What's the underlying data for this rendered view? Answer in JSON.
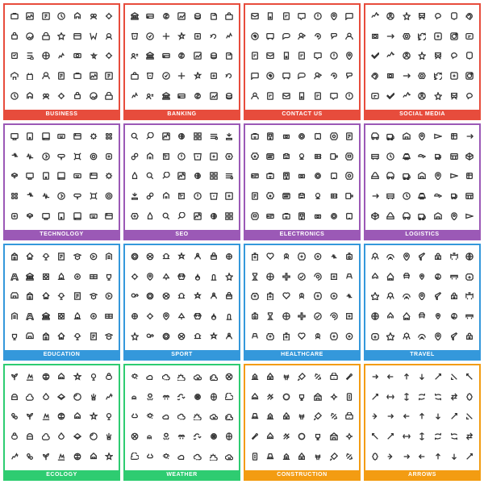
{
  "categories": [
    {
      "id": "business",
      "label": "BUSINESS",
      "class": "business",
      "icons": [
        "💼",
        "📊",
        "🏢",
        "📈",
        "👔",
        "🤝",
        "💡",
        "📋",
        "⚙️",
        "📌",
        "💰",
        "🖊",
        "📧",
        "📁",
        "👥",
        "📉",
        "🔗",
        "🏆",
        "💳",
        "📅",
        "🎯",
        "📑",
        "🔒",
        "🗂",
        "⏰",
        "📬",
        "💎",
        "🌐",
        "🔔",
        "🎖",
        "📣",
        "📞",
        "🗑",
        "✉",
        "🔑"
      ]
    },
    {
      "id": "banking",
      "label": "BANKING",
      "class": "banking",
      "icons": [
        "🏛",
        "💴",
        "📊",
        "💰",
        "🏦",
        "🐷",
        "💳",
        "🔐",
        "🏅",
        "📈",
        "⚖",
        "💵",
        "🪙",
        "🔒",
        "🧾",
        "💹",
        "📉",
        "🏧",
        "🔑",
        "💼",
        "🎖",
        "📋",
        "⚙",
        "🗃",
        "💡",
        "🤝",
        "💎",
        "📑",
        "🔔",
        "💱",
        "🛡",
        "🗝",
        "📌",
        "📅",
        "✅"
      ]
    },
    {
      "id": "contact",
      "label": "CONTACT US",
      "class": "contact",
      "icons": [
        "✉",
        "📞",
        "📱",
        "💬",
        "📨",
        "👥",
        "🔔",
        "📧",
        "🗺",
        "📲",
        "💌",
        "🎙",
        "🌐",
        "📩",
        "🗣",
        "📫",
        "📬",
        "🖥",
        "📡",
        "💡",
        "🔗",
        "📝",
        "📋",
        "⏰",
        "🔑",
        "👤",
        "📊",
        "📌",
        "🏠",
        "📣",
        "⚙",
        "🔔",
        "💼",
        "🤝",
        "🌍"
      ]
    },
    {
      "id": "social",
      "label": "SOCIAL MEDIA",
      "class": "social",
      "icons": [
        "👍",
        "🔔",
        "💬",
        "⭐",
        "🔗",
        "📊",
        "👁",
        "❤",
        "🔁",
        "📤",
        "🌐",
        "🎯",
        "📸",
        "💡",
        "🏆",
        "👥",
        "🎖",
        "📈",
        "💌",
        "🔒",
        "📲",
        "🌟",
        "📣",
        "🎪",
        "🏅",
        "📧",
        "⚙",
        "👤",
        "💎",
        "🎙",
        "📱",
        "✉",
        "📋",
        "🗣",
        "📡"
      ]
    },
    {
      "id": "technology",
      "label": "TECHNOLOGY",
      "class": "technology",
      "icons": [
        "💻",
        "📱",
        "🖥",
        "⌨",
        "🖨",
        "🖱",
        "💾",
        "📀",
        "🔌",
        "🔋",
        "📡",
        "⚙",
        "🤖",
        "🔧",
        "💡",
        "🛰",
        "🔬",
        "🧲",
        "🖲",
        "📲",
        "☁",
        "🔐",
        "💿",
        "🔩",
        "🧩",
        "📊",
        "🖼",
        "⚡",
        "🌐",
        "🔭",
        "🛠",
        "🔑",
        "💠",
        "📟",
        "🧬"
      ]
    },
    {
      "id": "seo",
      "label": "SEO",
      "class": "seo",
      "icons": [
        "🔍",
        "📊",
        "🎯",
        "🔗",
        "📈",
        "💡",
        "⚙",
        "🌐",
        "📋",
        "🏆",
        "🔑",
        "📱",
        "👁",
        "🖥",
        "📉",
        "🔔",
        "🔒",
        "💬",
        "📌",
        "🗺",
        "⭐",
        "📣",
        "🎖",
        "🔧",
        "✏",
        "📝",
        "💻",
        "🌟",
        "🛠",
        "📅",
        "🔁",
        "💰",
        "📡",
        "🔐",
        "🗂"
      ]
    },
    {
      "id": "electronics",
      "label": "ELECTRONICS",
      "class": "electronics",
      "icons": [
        "📺",
        "📷",
        "🎧",
        "💻",
        "📱",
        "🖥",
        "🔋",
        "🔌",
        "📡",
        "🎮",
        "⌚",
        "📠",
        "📻",
        "🔭",
        "🎙",
        "📸",
        "🖨",
        "💾",
        "🔦",
        "⚡",
        "🧲",
        "🔬",
        "🖱",
        "🎚",
        "💿",
        "📀",
        "🔔",
        "⚙",
        "🛰",
        "🔩",
        "💡",
        "🌡",
        "🎛",
        "📟",
        "🔧"
      ]
    },
    {
      "id": "logistics",
      "label": "LOGISTICS",
      "class": "logistics",
      "icons": [
        "🚛",
        "📦",
        "🏭",
        "🗺",
        "⏰",
        "🔗",
        "📋",
        "🚀",
        "🏪",
        "📊",
        "🚢",
        "✈",
        "⚙",
        "🔔",
        "🛣",
        "📌",
        "🏗",
        "🔒",
        "📅",
        "🚁",
        "🔑",
        "🗃",
        "🌐",
        "💡",
        "🔧",
        "📈",
        "🏆",
        "🛤",
        "🚂",
        "🔐",
        "📡",
        "🗂",
        "🛠",
        "💰",
        "🎯"
      ]
    },
    {
      "id": "education",
      "label": "EDUCATION",
      "class": "education",
      "icons": [
        "📚",
        "🎓",
        "✏",
        "📝",
        "🏫",
        "🔬",
        "🔭",
        "📐",
        "📏",
        "🖊",
        "💡",
        "🌍",
        "🎨",
        "📖",
        "🖥",
        "🧮",
        "📊",
        "🎭",
        "🏆",
        "🔑",
        "🎒",
        "📋",
        "🗂",
        "⏰",
        "💬",
        "🔔",
        "📌",
        "🌡",
        "🧪",
        "🗃",
        "🎖",
        "🖼",
        "🎵",
        "📅",
        "👤"
      ]
    },
    {
      "id": "sport",
      "label": "SPORT",
      "class": "sport",
      "icons": [
        "⚽",
        "🏀",
        "🏈",
        "🎾",
        "🏐",
        "🥊",
        "🏋",
        "🚴",
        "🏊",
        "🎿",
        "⛷",
        "🏆",
        "🥇",
        "🎯",
        "🏇",
        "🏸",
        "⛳",
        "🎱",
        "🥋",
        "🏒",
        "🎣",
        "🏄",
        "🧗",
        "⚡",
        "🚣",
        "🏓",
        "🎽",
        "🥅",
        "🏟",
        "⏱",
        "🎖",
        "🧘",
        "🚵",
        "🏂",
        "🤸"
      ]
    },
    {
      "id": "healthcare",
      "label": "HEALTHCARE",
      "class": "healthcare",
      "icons": [
        "🏥",
        "💊",
        "🩺",
        "🔬",
        "🧬",
        "❤",
        "🩹",
        "💉",
        "🧪",
        "🏃",
        "⚕",
        "🩻",
        "🧠",
        "💆",
        "🌡",
        "🩼",
        "🧴",
        "👁",
        "🦷",
        "🫀",
        "🫁",
        "🧫",
        "🔭",
        "💪",
        "🧘",
        "🚑",
        "🩺",
        "🏋",
        "⚖",
        "🌿",
        "💡",
        "🔑",
        "📋",
        "⏰",
        "🎯"
      ]
    },
    {
      "id": "travel",
      "label": "TRAVEL",
      "class": "travel",
      "icons": [
        "✈",
        "🌍",
        "🗺",
        "🏨",
        "🧳",
        "🚂",
        "🚢",
        "🏖",
        "🗻",
        "🌄",
        "🧭",
        "🏔",
        "🎒",
        "🛂",
        "🌐",
        "⛺",
        "🚗",
        "🛳",
        "🎭",
        "🌅",
        "🏛",
        "🍹",
        "🔑",
        "📸",
        "🗽",
        "🏕",
        "🎡",
        "🌊",
        "🚁",
        "🏝",
        "⛵",
        "🎟",
        "🌴",
        "🦭",
        "🎑"
      ]
    },
    {
      "id": "ecology",
      "label": "ECOLOGY",
      "class": "ecology",
      "icons": [
        "🌿",
        "♻",
        "🌍",
        "☀",
        "🌱",
        "💧",
        "🌳",
        "🌻",
        "🍃",
        "⚡",
        "🌊",
        "🌬",
        "🔋",
        "🌾",
        "🍀",
        "🦋",
        "🌺",
        "🐝",
        "🌏",
        "💡",
        "🌲",
        "🌈",
        "🏔",
        "🌾",
        "🐋",
        "🔆",
        "🍎",
        "🌵",
        "🐦",
        "🌼",
        "🐢",
        "🌙",
        "🌟",
        "♻",
        "🍂"
      ]
    },
    {
      "id": "weather",
      "label": "WEATHER",
      "class": "weather",
      "icons": [
        "⛅",
        "🌧",
        "❄",
        "☀",
        "🌪",
        "🌈",
        "⛈",
        "🌩",
        "🌫",
        "💨",
        "🌊",
        "🌡",
        "⛄",
        "🌙",
        "⚡",
        "🌤",
        "🌦",
        "🌨",
        "🌬",
        "☁",
        "🔆",
        "🌂",
        "⛅",
        "🌅",
        "🌞",
        "❄",
        "💧",
        "🌃",
        "🌏",
        "⭐",
        "🔭",
        "⛵",
        "🌄",
        "🌁",
        "🌮"
      ]
    },
    {
      "id": "construction",
      "label": "CONSTRUCTION",
      "class": "construction",
      "icons": [
        "🏗",
        "🔧",
        "🔨",
        "⚙",
        "🏚",
        "📐",
        "🔩",
        "🪛",
        "🛠",
        "🧱",
        "🏠",
        "⛏",
        "🪚",
        "💡",
        "🔑",
        "🏗",
        "🗂",
        "📋",
        "🚜",
        "🏭",
        "🪝",
        "🔌",
        "🧯",
        "⚠",
        "🔒",
        "📏",
        "🗑",
        "🚧",
        "🏆",
        "⚡",
        "🔔",
        "📊",
        "🎯",
        "🌐",
        "💼"
      ]
    },
    {
      "id": "arrows",
      "label": "ARROWS",
      "class": "arrows",
      "icons": [
        "→",
        "←",
        "↑",
        "↓",
        "↗",
        "↘",
        "↙",
        "↖",
        "↔",
        "↕",
        "⟳",
        "⟲",
        "⇒",
        "⇐",
        "⇑",
        "⇓",
        "➡",
        "⬅",
        "⬆",
        "⬇",
        "↩",
        "↪",
        "🔄",
        "⏩",
        "⏪",
        "⏫",
        "⏬",
        "🔃",
        "↱",
        "↰",
        "↲",
        "↳",
        "⤴",
        "⤵",
        "⟵"
      ]
    }
  ]
}
